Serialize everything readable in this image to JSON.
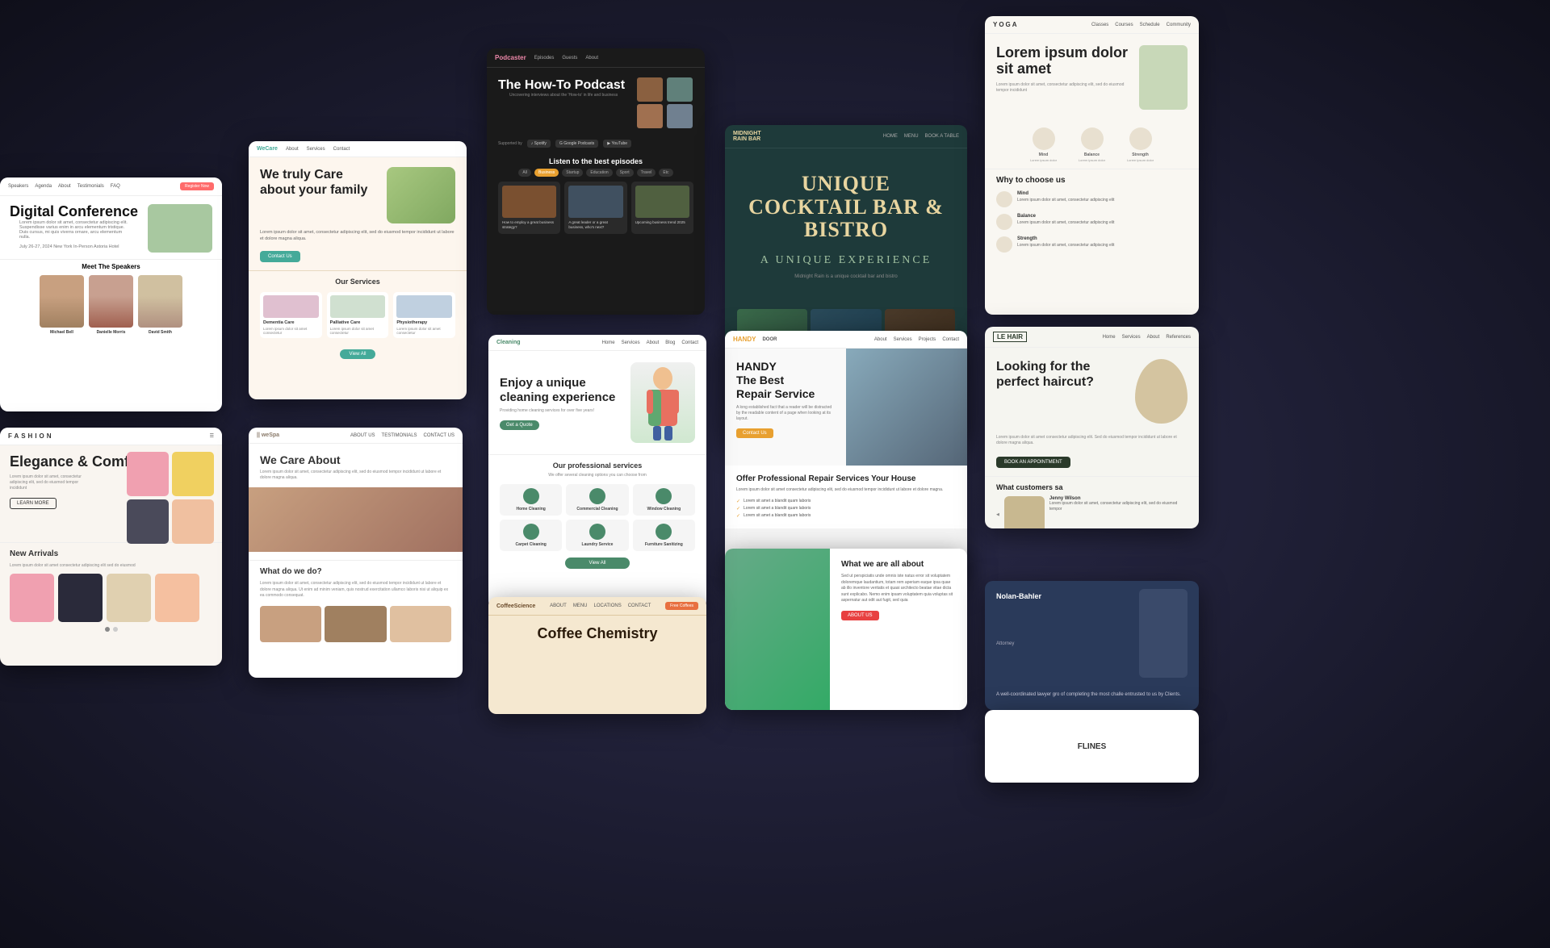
{
  "cards": {
    "conference": {
      "nav_items": [
        "Speakers",
        "Agenda",
        "About",
        "Testimonials",
        "FAQ"
      ],
      "register_btn": "Register Now",
      "title": "Digital Conference",
      "description": "Lorem ipsum dolor sit amet, consectetur adipiscing elit. Suspendisse varius enim in arcu elementum tristique. Duis cursus, mi quis viverra ornare, arcu elementum nulla.",
      "date": "July 26-27, 2024  New York  In-Person  Astoria Hotel",
      "speakers_title": "Meet The Speakers",
      "speakers": [
        {
          "name": "Michael Bell"
        },
        {
          "name": "Danielle Morris"
        },
        {
          "name": "David Smith"
        }
      ]
    },
    "wecare": {
      "logo": "WeCare",
      "nav_items": [
        "About",
        "Services",
        "Contact"
      ],
      "headline": "We truly Care about your family",
      "description": "Lorem ipsum dolor sit amet, consectetur adipiscing elit, sed do eiusmod tempor incididunt ut labore et dolore magna aliqua.",
      "button": "Contact Us",
      "services_title": "Our Services",
      "services": [
        {
          "name": "Dementia Care",
          "desc": "Lorem ipsum dolor sit amet consectetur"
        },
        {
          "name": "Palliative Care",
          "desc": "Lorem ipsum dolor sit amet consectetur"
        },
        {
          "name": "Physiotherapy",
          "desc": "Lorem ipsum dolor sit amet consectetur"
        }
      ],
      "view_all": "View All"
    },
    "podcast": {
      "logo": "Podcaster",
      "nav_items": [
        "Episodes",
        "Guests",
        "About"
      ],
      "title": "The How-To Podcast",
      "description": "Uncovering interviews about the 'How-to' in life and business",
      "platform_label": "Supported by",
      "platforms": [
        "Spotify",
        "Google Podcasts",
        "YouTube"
      ],
      "episodes_title": "Listen to the best episodes",
      "filter_labels": [
        "All",
        "Business",
        "Startup",
        "Education",
        "Sport",
        "Travel",
        "Etc"
      ],
      "active_filter": "Business",
      "episodes": [
        {
          "title": "How to employ a great business strategy?"
        },
        {
          "title": "A great leader or a great business, who's next?"
        },
        {
          "title": "Upcoming business trend 2025"
        }
      ]
    },
    "cocktail": {
      "logo": "MIDNIGHT RAIN BAR",
      "nav_items": [
        "HOME",
        "MENU",
        "BOOK A TABLE"
      ],
      "headline": "UNIQUE COCKTAIL BAR & BISTRO",
      "subheadline": "A UNIQUE EXPERIENCE",
      "description": "Midnight Rain is a unique cocktail bar and bistro"
    },
    "handy": {
      "logo": "HANDY DOOR",
      "nav_items": [
        "About",
        "Services",
        "Projects",
        "Contact"
      ],
      "headline": "HANDY The Best Repair Service",
      "description": "A long established fact that a reader will be distracted by the readable content of a page when looking at its layout.",
      "button": "Contact Us",
      "offer_title": "Offer Professional Repair Services Your House",
      "offer_desc": "Lorem ipsum dolor sit amet consectetur adipiscing elit, sed do eiusmod tempor incididunt ut labore et dolore magna.",
      "checklist": [
        "Lorem sit amet a blandit quam laboris",
        "Lorem sit amet a blandit quam laboris",
        "Lorem sit amet a blandit quam laboris"
      ]
    },
    "garden": {
      "title": "What we are all about",
      "description": "Sed ut perspiciatis unde omnis iste natus error sit voluptatem doloremque laudantium, totam rem aperiam eaque ipsa quae ab illo inventore veritatis et quasi architecto beatae vitae dicta sunt explicabo. Nemo enim ipsam voluptatem quia voluptas sit aspernatur aut odit aut fugit, sed quia",
      "button": "ABOUT US"
    },
    "yoga": {
      "logo": "YOGA",
      "nav_items": [
        "Classes",
        "Courses",
        "Schedule",
        "Community"
      ],
      "headline": "Lorem ipsum dolor sit amet",
      "description": "Lorem ipsum dolor sit amet, consectetur adipiscing elit, sed do eiusmod tempor incididunt",
      "icons": [
        {
          "name": "Mind"
        },
        {
          "name": "Balance"
        },
        {
          "name": "Strength"
        }
      ],
      "why_title": "Why to choose us",
      "why_items": [
        {
          "name": "Mind",
          "desc": "Lorem ipsum dolor sit amet, consectetur adipiscing elit"
        },
        {
          "name": "Balance",
          "desc": "Lorem ipsum dolor sit amet, consectetur adipiscing elit"
        },
        {
          "name": "Strength",
          "desc": "Lorem ipsum dolor sit amet, consectetur adipiscing elit"
        }
      ]
    },
    "lehair": {
      "logo": "LE HAIR",
      "nav_items": [
        "Home",
        "Services",
        "About",
        "References"
      ],
      "headline": "Looking for the perfect haircut?",
      "description": "Lorem ipsum dolor sit amet consectetur adipiscing elit. Sed do eiusmod tempor incididunt ut labore et dolore magna aliqua.",
      "button": "BOOK AN APPOINTMENT",
      "customers_title": "What customers sa",
      "reviewer": "Jenny Wilson",
      "review": "Lorem ipsum dolor sit amet, consectetur adipiscing elit, sed do eiusmod tempor"
    },
    "lawyer": {
      "name": "Nolan-Bahler",
      "quote": "A well-coordinated lawyer gro of completing the most challe entrusted to us by Clients."
    },
    "fashion": {
      "logo": "FASHION",
      "headline": "Elegance & Comfort",
      "description": "Lorem ipsum dolor sit amet, consectetur adipiscing elit, sed do eiusmod tempor incididunt",
      "button": "LEARN MORE",
      "new_arrivals_title": "New Arrivals",
      "new_arrivals_desc": "Lorem ipsum dolor sit amet consectetur adipiscing elit sed do eiusmod"
    },
    "wespa": {
      "logo": "|| weSpa",
      "nav_items": [
        "ABOUT US",
        "TESTIMONIALS",
        "CONTACT US"
      ],
      "care_title": "We Care About",
      "care_desc": "Lorem ipsum dolor sit amet, consectetur adipiscing elit, sed do eiusmod tempor incididunt ut labore et dolore magna aliqua.",
      "what_title": "What do we do?",
      "what_desc": "Lorem ipsum dolor sit amet, consectetur adipiscing elit, sed do eiusmod tempor incididunt ut labore et dolore magna aliqua. Ut enim ad minim veniam, quis nostrud exercitation ullamco laboris nisi ut aliquip ex ea commodo consequat."
    },
    "cleaning": {
      "logo": "Cleaning",
      "nav_items": [
        "Home",
        "Services",
        "About",
        "Blog",
        "Contact"
      ],
      "headline": "Enjoy a unique cleaning experience",
      "description": "Providing home cleaning services for over five years!",
      "button": "Get a Quote",
      "services_title": "Our professional services",
      "services_desc": "We offer several cleaning options you can choose from",
      "services": [
        {
          "name": "Home Cleaning"
        },
        {
          "name": "Commercial Cleaning"
        },
        {
          "name": "Window Cleaning"
        },
        {
          "name": "Carpet Cleaning"
        },
        {
          "name": "Laundry Service"
        },
        {
          "name": "Furniture Sanitizing"
        }
      ],
      "view_btn": "View All"
    },
    "coffee": {
      "logo": "CoffeeScience",
      "nav_items": [
        "ABOUT",
        "MENU",
        "LOCATIONS",
        "CONTACT"
      ],
      "register_btn": "Free Coffees",
      "headline": "Coffee Chemistry"
    },
    "flines": {
      "label": "FLINES"
    }
  }
}
